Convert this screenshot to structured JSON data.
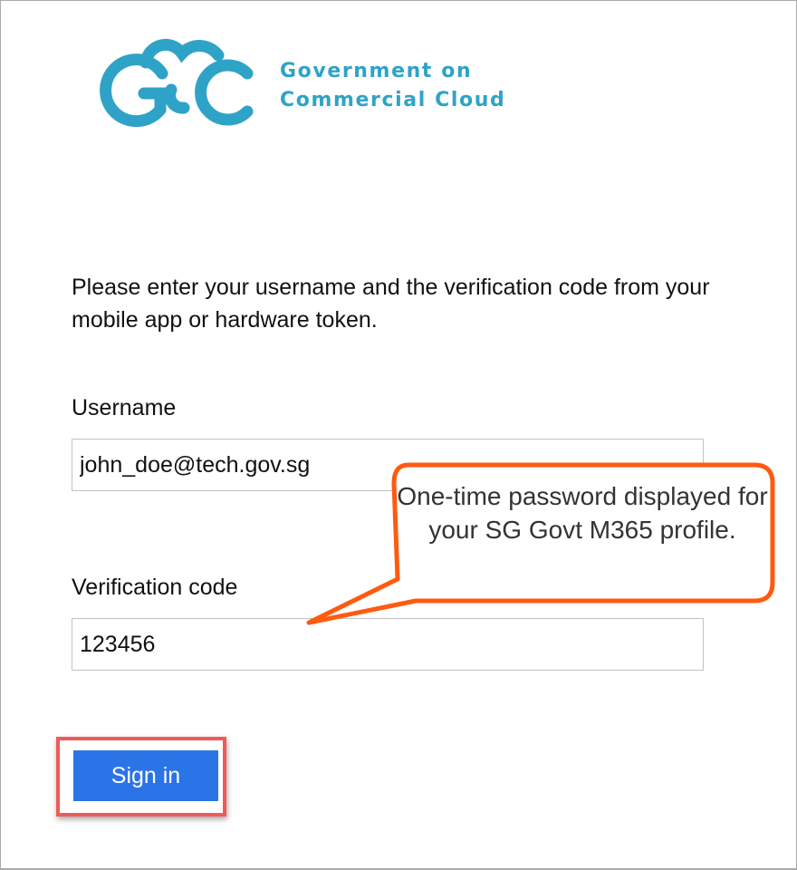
{
  "logo": {
    "org_line1": "Government on",
    "org_line2": "Commercial Cloud",
    "brand_color": "#2fa3c7",
    "icon": "gcc-cloud-logo"
  },
  "instructions": "Please enter your username and the verification code from your mobile app or hardware token.",
  "username": {
    "label": "Username",
    "value": "john_doe@tech.gov.sg"
  },
  "verification": {
    "label": "Verification code",
    "value": "123456"
  },
  "callout": {
    "text": "One-time password displayed for your SG Govt M365 profile.",
    "border_color": "#ff5a0f"
  },
  "signin": {
    "label": "Sign in",
    "button_color": "#2b74e8",
    "highlight_color": "#ef5b5b"
  }
}
